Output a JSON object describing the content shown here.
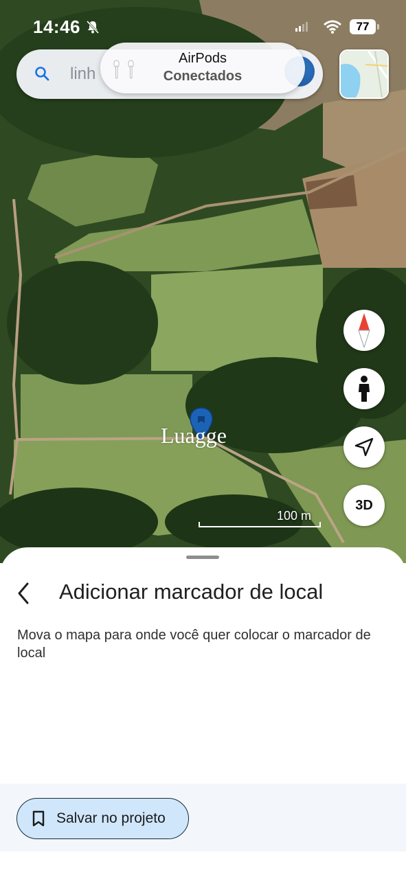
{
  "status_bar": {
    "time": "14:46",
    "battery": "77"
  },
  "search": {
    "partial_text": "linh"
  },
  "airpods_toast": {
    "title": "AirPods",
    "subtitle": "Conectados"
  },
  "map": {
    "watermark": "Luagge",
    "scale_label": "100 m"
  },
  "controls": {
    "three_d_label": "3D"
  },
  "sheet": {
    "title": "Adicionar marcador de local",
    "description": "Mova o mapa para onde você quer colocar o marcador de local",
    "save_button_label": "Salvar no projeto"
  },
  "colors": {
    "accent": "#1a73e8",
    "save_button_bg": "#cfe6fb",
    "pin": "#1c63b5"
  }
}
